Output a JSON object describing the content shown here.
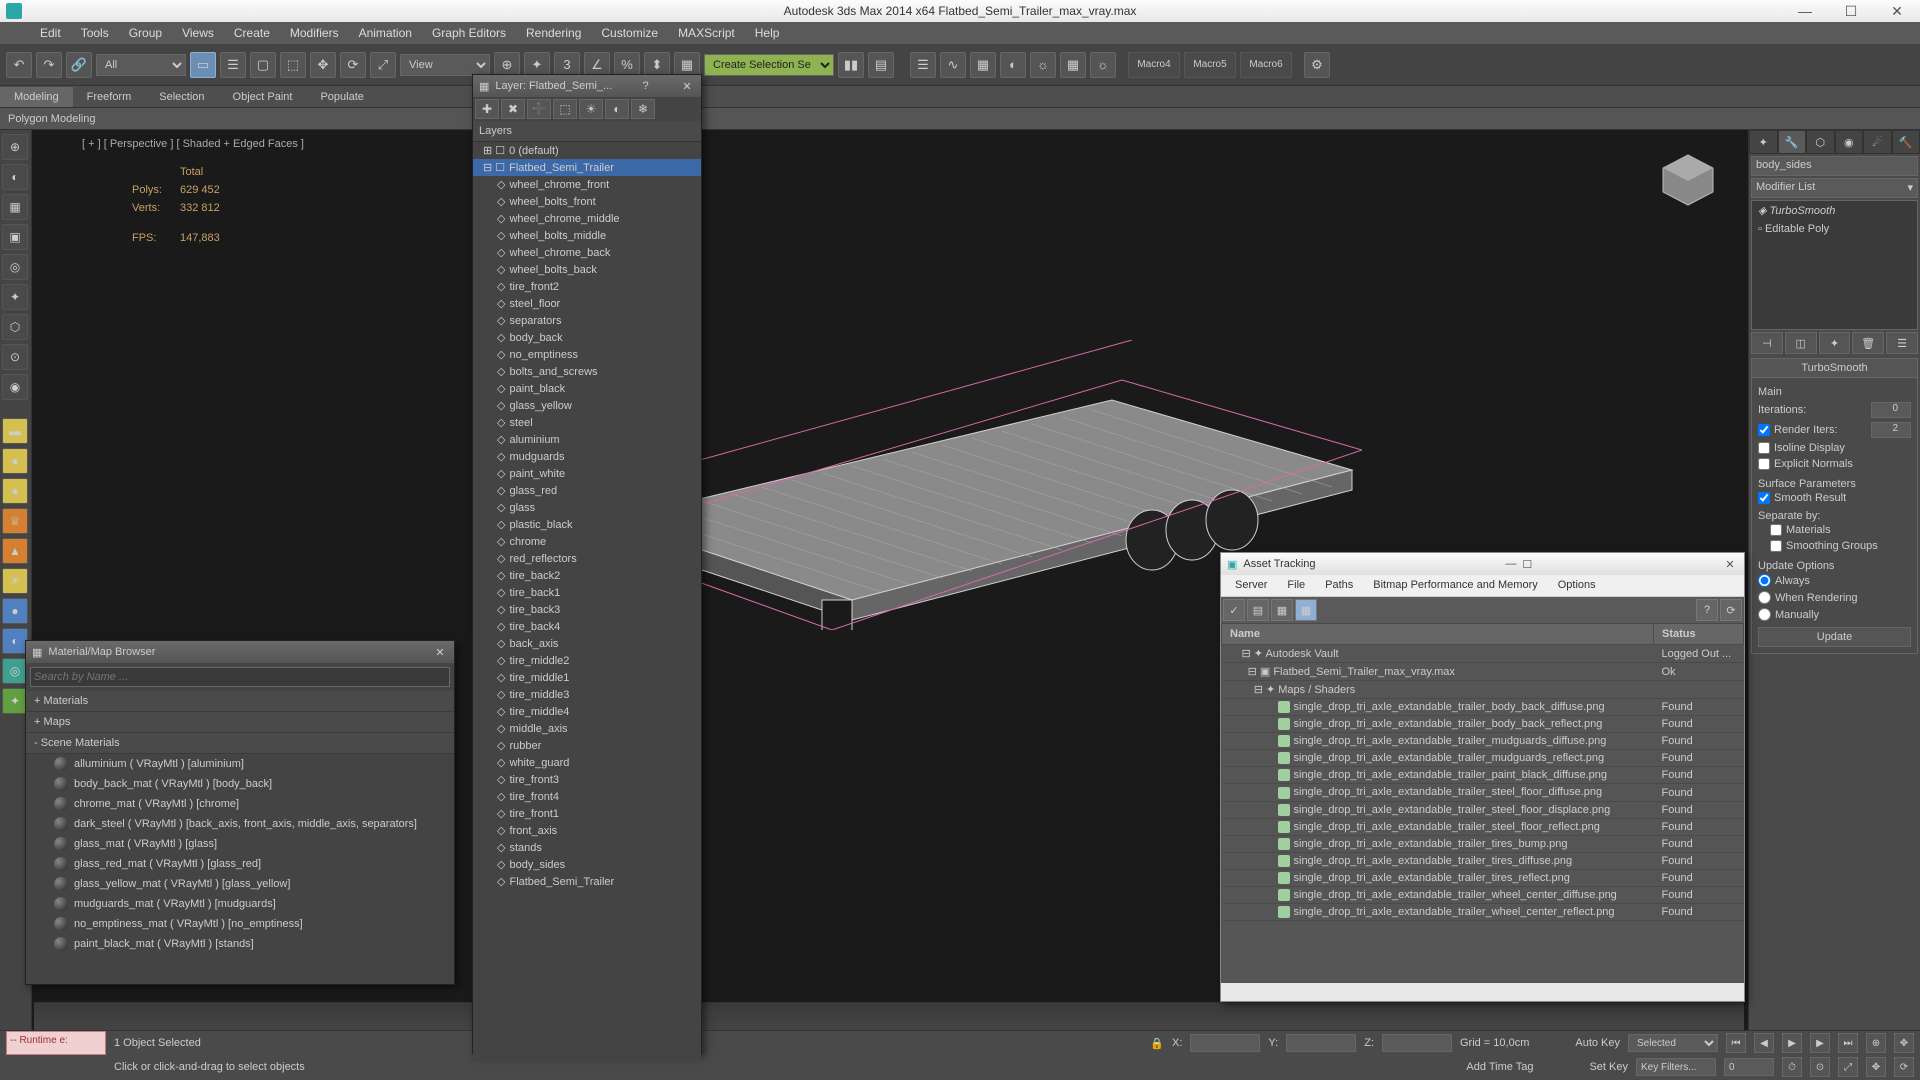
{
  "title": "Autodesk 3ds Max  2014 x64      Flatbed_Semi_Trailer_max_vray.max",
  "menus": [
    "Edit",
    "Tools",
    "Group",
    "Views",
    "Create",
    "Modifiers",
    "Animation",
    "Graph Editors",
    "Rendering",
    "Customize",
    "MAXScript",
    "Help"
  ],
  "toolbar": {
    "sel_all": "All",
    "sel_view": "View",
    "selset": "Create Selection Se"
  },
  "macros": [
    "Macro4",
    "Macro5",
    "Macro6"
  ],
  "ribbon_tabs": [
    "Modeling",
    "Freeform",
    "Selection",
    "Object Paint",
    "Populate"
  ],
  "ribbon_active": "Modeling",
  "subbar": "Polygon Modeling",
  "viewport": {
    "label": "[ + ] [ Perspective ] [ Shaded + Edged Faces ]",
    "stats": {
      "poly_label": "Polys:",
      "vert_label": "Verts:",
      "fps_label": "FPS:",
      "total": "Total",
      "polys": "629 452",
      "verts": "332 812",
      "fps": "147,883"
    }
  },
  "cmdpanel": {
    "objname": "body_sides",
    "modlist": "Modifier List",
    "stack": [
      "TurboSmooth",
      "Editable Poly"
    ],
    "rollout_name": "TurboSmooth",
    "main": "Main",
    "iterations": "Iterations:",
    "iter_val": "0",
    "render_iters": "Render Iters:",
    "riter_val": "2",
    "isoline": "Isoline Display",
    "explicit": "Explicit Normals",
    "surfparam": "Surface Parameters",
    "smooth": "Smooth Result",
    "separate": "Separate by:",
    "sep_mat": "Materials",
    "sep_sg": "Smoothing Groups",
    "update_opt": "Update Options",
    "opt_always": "Always",
    "opt_render": "When Rendering",
    "opt_manual": "Manually",
    "update_btn": "Update"
  },
  "material_browser": {
    "title": "Material/Map Browser",
    "search": "Search by Name ...",
    "grp_materials": "+ Materials",
    "grp_maps": "+ Maps",
    "grp_scene": "- Scene Materials",
    "items": [
      "alluminium ( VRayMtl ) [aluminium]",
      "body_back_mat ( VRayMtl ) [body_back]",
      "chrome_mat ( VRayMtl ) [chrome]",
      "dark_steel ( VRayMtl ) [back_axis, front_axis, middle_axis, separators]",
      "glass_mat ( VRayMtl ) [glass]",
      "glass_red_mat ( VRayMtl ) [glass_red]",
      "glass_yellow_mat ( VRayMtl ) [glass_yellow]",
      "mudguards_mat ( VRayMtl ) [mudguards]",
      "no_emptiness_mat ( VRayMtl ) [no_emptiness]",
      "paint_black_mat ( VRayMtl ) [stands]"
    ]
  },
  "layer_dlg": {
    "title": "Layer: Flatbed_Semi_...",
    "layers_col": "Layers",
    "default": "0 (default)",
    "selected": "Flatbed_Semi_Trailer",
    "items": [
      "wheel_chrome_front",
      "wheel_bolts_front",
      "wheel_chrome_middle",
      "wheel_bolts_middle",
      "wheel_chrome_back",
      "wheel_bolts_back",
      "tire_front2",
      "steel_floor",
      "separators",
      "body_back",
      "no_emptiness",
      "bolts_and_screws",
      "paint_black",
      "glass_yellow",
      "steel",
      "aluminium",
      "mudguards",
      "paint_white",
      "glass_red",
      "glass",
      "plastic_black",
      "chrome",
      "red_reflectors",
      "tire_back2",
      "tire_back1",
      "tire_back3",
      "tire_back4",
      "back_axis",
      "tire_middle2",
      "tire_middle1",
      "tire_middle3",
      "tire_middle4",
      "middle_axis",
      "rubber",
      "white_guard",
      "tire_front3",
      "tire_front4",
      "tire_front1",
      "front_axis",
      "stands",
      "body_sides",
      "Flatbed_Semi_Trailer"
    ]
  },
  "asset_dlg": {
    "title": "Asset Tracking",
    "menus": [
      "Server",
      "File",
      "Paths",
      "Bitmap Performance and Memory",
      "Options"
    ],
    "col_name": "Name",
    "col_status": "Status",
    "vault": "Autodesk Vault",
    "vault_status": "Logged Out ...",
    "scene": "Flatbed_Semi_Trailer_max_vray.max",
    "scene_status": "Ok",
    "maps": "Maps / Shaders",
    "files": [
      "single_drop_tri_axle_extandable_trailer_body_back_diffuse.png",
      "single_drop_tri_axle_extandable_trailer_body_back_reflect.png",
      "single_drop_tri_axle_extandable_trailer_mudguards_diffuse.png",
      "single_drop_tri_axle_extandable_trailer_mudguards_reflect.png",
      "single_drop_tri_axle_extandable_trailer_paint_black_diffuse.png",
      "single_drop_tri_axle_extandable_trailer_steel_floor_diffuse.png",
      "single_drop_tri_axle_extandable_trailer_steel_floor_displace.png",
      "single_drop_tri_axle_extandable_trailer_steel_floor_reflect.png",
      "single_drop_tri_axle_extandable_trailer_tires_bump.png",
      "single_drop_tri_axle_extandable_trailer_tires_diffuse.png",
      "single_drop_tri_axle_extandable_trailer_tires_reflect.png",
      "single_drop_tri_axle_extandable_trailer_wheel_center_diffuse.png",
      "single_drop_tri_axle_extandable_trailer_wheel_center_reflect.png"
    ],
    "found": "Found"
  },
  "status": {
    "selcount": "1 Object Selected",
    "hint": "Click or click-and-drag to select objects",
    "runtime": "-- Runtime e:",
    "xlabel": "X:",
    "ylabel": "Y:",
    "zlabel": "Z:",
    "grid": "Grid = 10,0cm",
    "addtag": "Add Time Tag",
    "autokey": "Auto Key",
    "setkey": "Set Key",
    "keymode": "Selected",
    "keyfilters": "Key Filters..."
  }
}
